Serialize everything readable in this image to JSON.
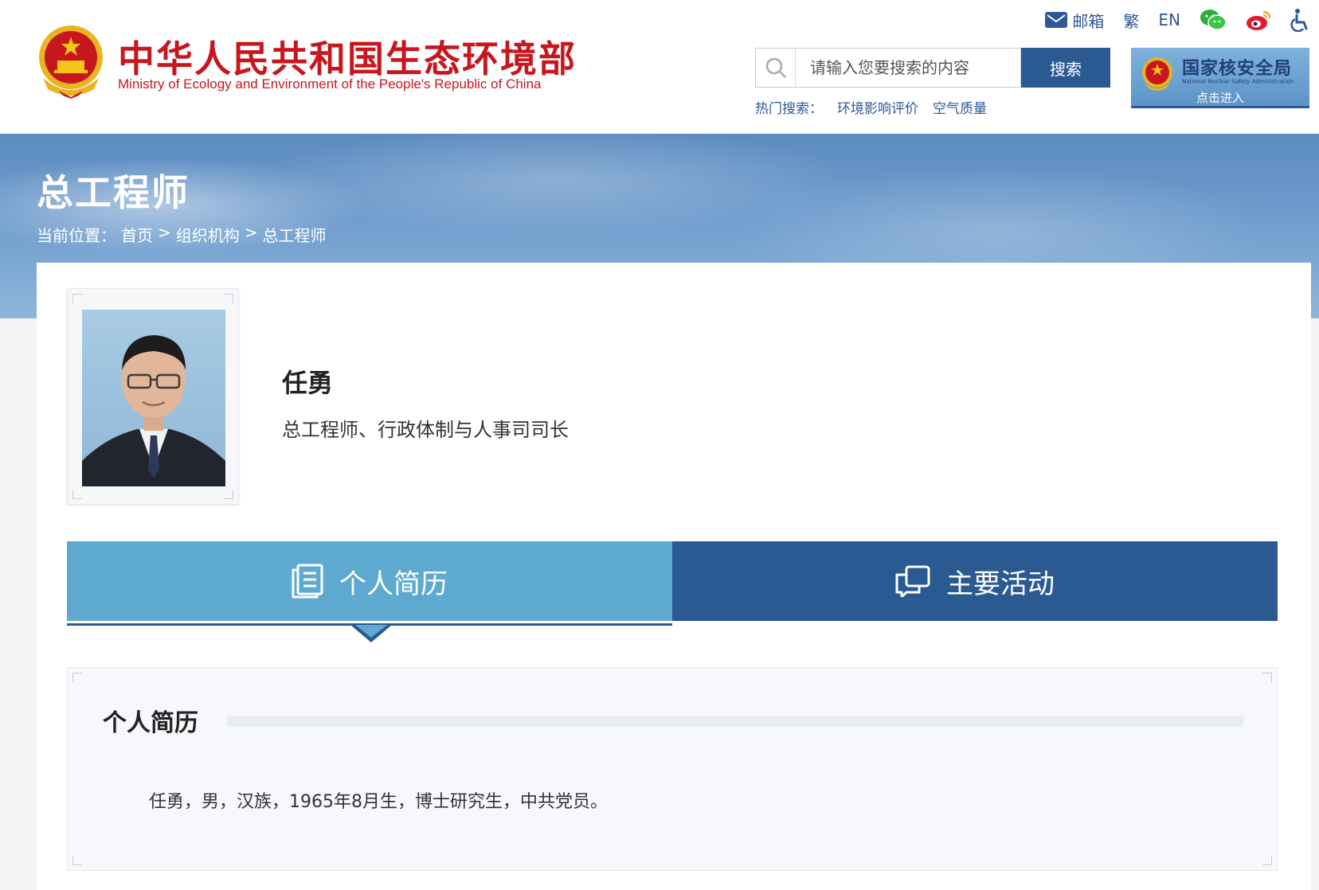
{
  "header": {
    "title_cn": "中华人民共和国生态环境部",
    "title_en": "Ministry of Ecology and Environment of the People's Republic of China",
    "top_links": {
      "mail": "邮箱",
      "traditional": "繁",
      "english": "EN"
    },
    "search": {
      "placeholder": "请输入您要搜索的内容",
      "button": "搜索"
    },
    "hot_search": {
      "label": "热门搜索：",
      "keywords": [
        "环境影响评价",
        "空气质量"
      ]
    },
    "nsa": {
      "title": "国家核安全局",
      "subtitle_en": "National Nuclear Safety Administration",
      "enter": "点击进入"
    }
  },
  "banner": {
    "title": "总工程师",
    "breadcrumb": {
      "label": "当前位置：",
      "items": [
        "首页",
        "组织机构",
        "总工程师"
      ],
      "separator": ">"
    }
  },
  "profile": {
    "name": "任勇",
    "position": "总工程师、行政体制与人事司司长"
  },
  "tabs": [
    {
      "label": "个人简历",
      "icon": "document-icon",
      "active": true
    },
    {
      "label": "主要活动",
      "icon": "chat-icon",
      "active": false
    }
  ],
  "bio": {
    "heading": "个人简历",
    "text": "任勇，男，汉族，1965年8月生，博士研究生，中共党员。"
  },
  "colors": {
    "brand_red": "#c8161d",
    "primary_blue": "#2b5a93",
    "active_tab": "#5ea9d0"
  }
}
